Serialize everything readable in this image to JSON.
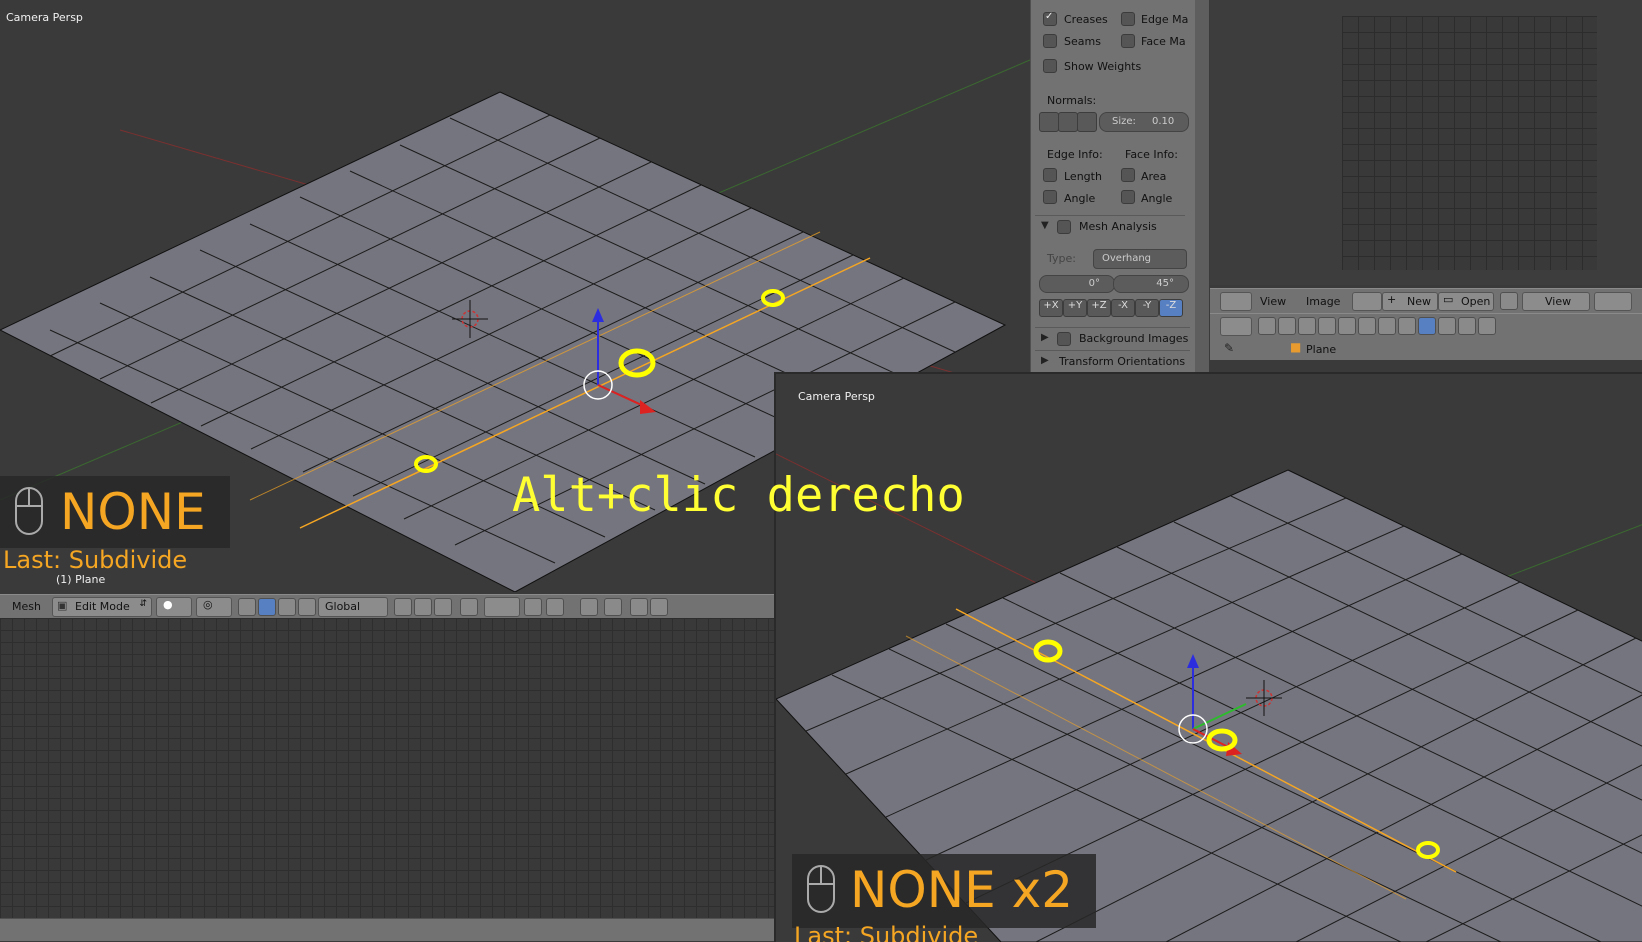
{
  "viewport_top": {
    "label": "Camera Persp",
    "key_hint": "NONE",
    "last_op": "Last: Subdivide",
    "object_label": "(1) Plane"
  },
  "viewport_bottom": {
    "label": "Camera Persp",
    "key_hint": "NONE x2",
    "last_op": "Last: Subdivide"
  },
  "overlay_caption": "Alt+clic derecho",
  "properties_panel": {
    "creases_label": "Creases",
    "edge_ma_label": "Edge Ma",
    "seams_label": "Seams",
    "face_ma_label": "Face Ma",
    "show_weights_label": "Show Weights",
    "normals_label": "Normals:",
    "size_label": "Size:",
    "size_value": "0.10",
    "edge_info_label": "Edge Info:",
    "face_info_label": "Face Info:",
    "length_label": "Length",
    "area_label": "Area",
    "angle_label": "Angle",
    "face_angle_label": "Angle",
    "mesh_analysis_label": "Mesh Analysis",
    "type_label": "Type:",
    "type_value": "Overhang",
    "min_angle": "0°",
    "max_angle": "45°",
    "axis_buttons": [
      "+X",
      "+Y",
      "+Z",
      "-X",
      "-Y",
      "-Z"
    ],
    "background_images_label": "Background Images",
    "transform_orientations_label": "Transform Orientations"
  },
  "view3d_header": {
    "menu_mesh": "Mesh",
    "mode": "Edit Mode",
    "orientation": "Global"
  },
  "image_editor_header": {
    "view": "View",
    "image": "Image",
    "new": "New",
    "open": "Open",
    "view2": "View"
  },
  "properties_header": {
    "context": "Plane"
  },
  "colors": {
    "viewport_bg": "#3a3a3a",
    "mesh_face": "#75757f",
    "selection": "#f5a623",
    "annotation": "#ffff00",
    "panel_bg": "#727272"
  }
}
